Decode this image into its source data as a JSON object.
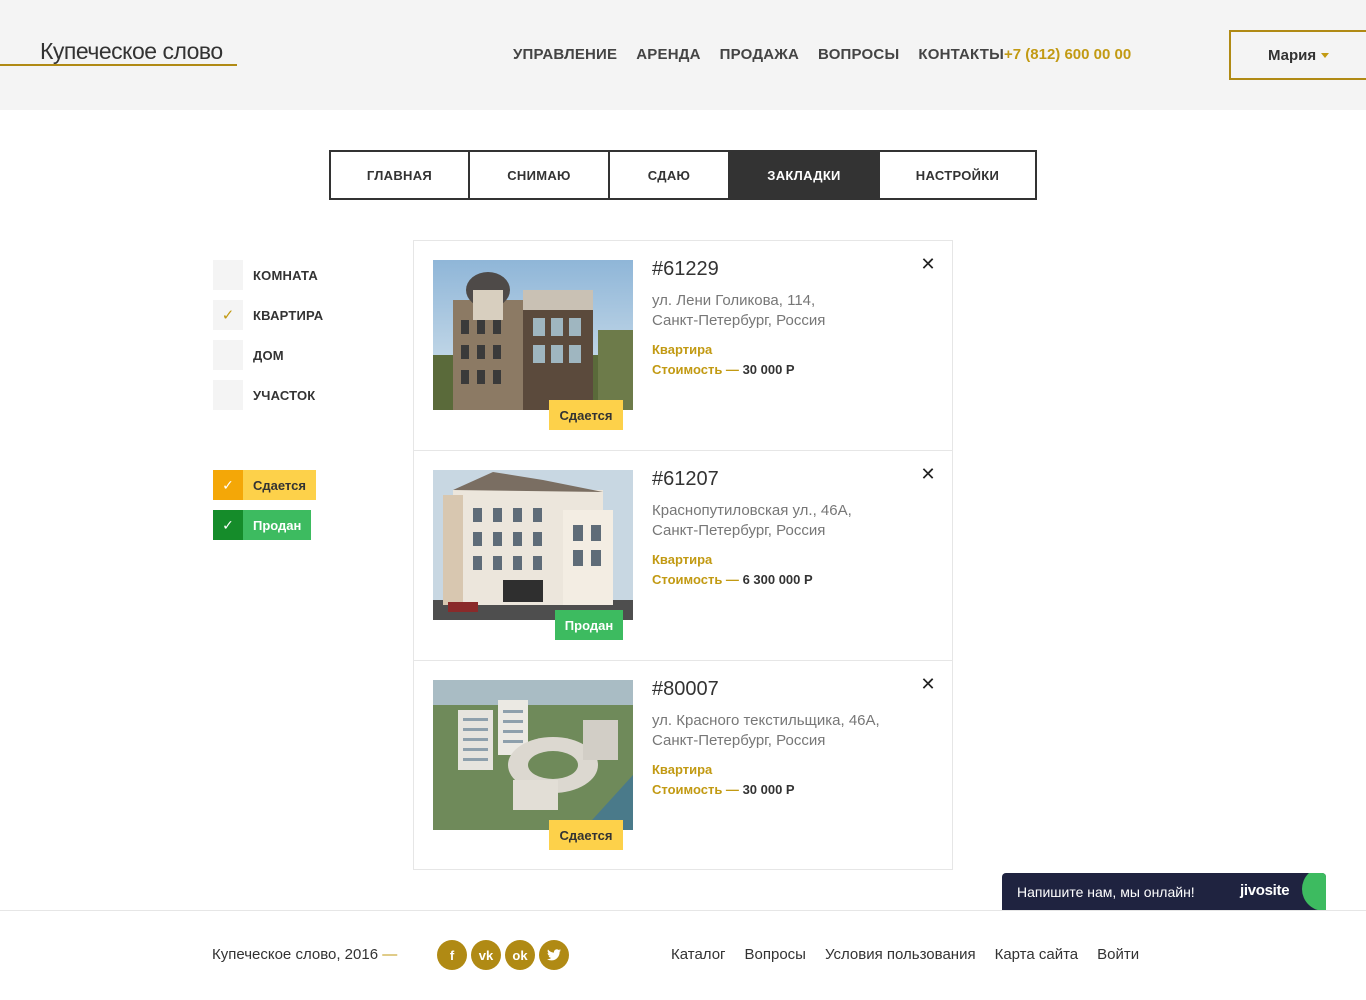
{
  "header": {
    "logo": "Купеческое слово",
    "nav": [
      "УПРАВЛЕНИЕ",
      "АРЕНДА",
      "ПРОДАЖА",
      "ВОПРОСЫ",
      "КОНТАКТЫ"
    ],
    "phone": "+7 (812) 600 00 00",
    "user": "Мария"
  },
  "tabs": [
    {
      "label": "ГЛАВНАЯ",
      "active": false
    },
    {
      "label": "СНИМАЮ",
      "active": false
    },
    {
      "label": "СДАЮ",
      "active": false
    },
    {
      "label": "ЗАКЛАДКИ",
      "active": true
    },
    {
      "label": "НАСТРОЙКИ",
      "active": false
    }
  ],
  "filters": {
    "types": [
      {
        "label": "КОМНАТА",
        "checked": false
      },
      {
        "label": "КВАРТИРА",
        "checked": true
      },
      {
        "label": "ДОМ",
        "checked": false
      },
      {
        "label": "УЧАСТОК",
        "checked": false
      }
    ],
    "statuses": [
      {
        "label": "Сдается",
        "checked": true
      },
      {
        "label": "Продан",
        "checked": true
      }
    ]
  },
  "listings": [
    {
      "id": "#61229",
      "address_line1": "ул. Лени Голикова, 114,",
      "address_line2": "Санкт-Петербург, Россия",
      "type": "Квартира",
      "price_label": "Стоимость —",
      "price": "30 000 Р",
      "status": "Сдается"
    },
    {
      "id": "#61207",
      "address_line1": "Краснопутиловская ул., 46А,",
      "address_line2": "Санкт-Петербург, Россия",
      "type": "Квартира",
      "price_label": "Стоимость —",
      "price": "6 300 000 Р",
      "status": "Продан"
    },
    {
      "id": "#80007",
      "address_line1": "ул. Красного текстильщика, 46А,",
      "address_line2": "Санкт-Петербург, Россия",
      "type": "Квартира",
      "price_label": "Стоимость —",
      "price": "30 000 Р",
      "status": "Сдается"
    }
  ],
  "footer": {
    "copyright": "Купеческое слово, 2016",
    "dash": "—",
    "social_icons": [
      "facebook-icon",
      "vk-icon",
      "odnoklassniki-icon",
      "twitter-icon"
    ],
    "links": [
      "Каталог",
      "Вопросы",
      "Условия пользования",
      "Карта сайта",
      "Войти"
    ]
  },
  "chat": {
    "text": "Напишите нам, мы онлайн!",
    "brand": "jivosite"
  },
  "colors": {
    "accent": "#c29a13",
    "rent": "#fdd14a",
    "sold": "#3dbb60",
    "dark": "#333333"
  }
}
